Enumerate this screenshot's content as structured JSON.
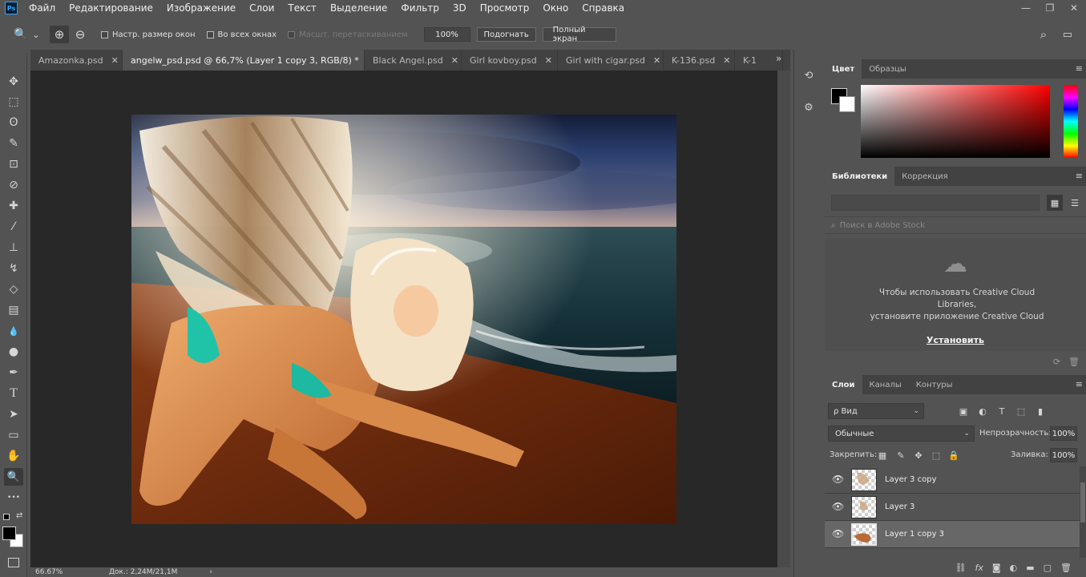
{
  "app": {
    "logo": "Ps",
    "accent": "#31a8ff"
  },
  "menu": [
    "Файл",
    "Редактирование",
    "Изображение",
    "Слои",
    "Текст",
    "Выделение",
    "Фильтр",
    "3D",
    "Просмотр",
    "Окно",
    "Справка"
  ],
  "window_controls": {
    "minimize": "—",
    "restore": "❐",
    "close": "✕"
  },
  "options": {
    "zoom_icon": "🔍",
    "chevron": "⌄",
    "zoom_in_icon": "⊕",
    "zoom_out_icon": "⊖",
    "resize_windows_label": "Настр. размер окон",
    "all_windows_label": "Во всех окнах",
    "scrubby_zoom_label": "Масшт. перетаскиванием",
    "zoom_value": "100%",
    "fit_screen_label": "Подогнать",
    "fill_screen_label": "Полный экран",
    "search_icon": "⌕",
    "workspace_icon": "▭"
  },
  "tabs": [
    {
      "title": "Amazonka.psd",
      "close": "✕",
      "active": false
    },
    {
      "title": "angelw_psd.psd @ 66,7% (Layer 1 copy 3, RGB/8) *",
      "close": "✕",
      "active": true
    },
    {
      "title": "Black Angel.psd",
      "close": "✕",
      "active": false
    },
    {
      "title": "Girl kovboy.psd",
      "close": "✕",
      "active": false
    },
    {
      "title": "Girl with cigar.psd",
      "close": "✕",
      "active": false
    },
    {
      "title": "K-136.psd",
      "close": "✕",
      "active": false
    },
    {
      "title": "K-1",
      "close": "",
      "active": false
    }
  ],
  "tab_overflow": "»",
  "tools": [
    {
      "name": "move-tool",
      "glyph": "✥"
    },
    {
      "name": "marquee-tool",
      "glyph": "⬚"
    },
    {
      "name": "lasso-tool",
      "glyph": "ʘ"
    },
    {
      "name": "quick-select-tool",
      "glyph": "✎"
    },
    {
      "name": "crop-tool",
      "glyph": "⊡"
    },
    {
      "name": "eyedropper-tool",
      "glyph": "⊘"
    },
    {
      "name": "healing-tool",
      "glyph": "✚"
    },
    {
      "name": "brush-tool",
      "glyph": "⁄"
    },
    {
      "name": "stamp-tool",
      "glyph": "⊥"
    },
    {
      "name": "history-brush-tool",
      "glyph": "↯"
    },
    {
      "name": "eraser-tool",
      "glyph": "◇"
    },
    {
      "name": "gradient-tool",
      "glyph": "▤"
    },
    {
      "name": "blur-tool",
      "glyph": "💧"
    },
    {
      "name": "dodge-tool",
      "glyph": "●"
    },
    {
      "name": "pen-tool",
      "glyph": "✒"
    },
    {
      "name": "type-tool",
      "glyph": "T"
    },
    {
      "name": "path-select-tool",
      "glyph": "➤"
    },
    {
      "name": "shape-tool",
      "glyph": "▭"
    },
    {
      "name": "hand-tool",
      "glyph": "✋"
    },
    {
      "name": "zoom-tool",
      "glyph": "🔍"
    },
    {
      "name": "more-tools",
      "glyph": "•••"
    }
  ],
  "status": {
    "zoom": "66.67%",
    "doc": "Док.: 2,24M/21,1M",
    "arrow": "›"
  },
  "strip_icons": {
    "history": "⟲",
    "properties": "⚙"
  },
  "color_panel": {
    "tabs": [
      "Цвет",
      "Образцы"
    ],
    "menu": "≡",
    "foreground": "#000000",
    "background": "#ffffff"
  },
  "libraries": {
    "tabs": [
      "Библиотеки",
      "Коррекция"
    ],
    "menu": "≡",
    "grid_icon": "▦",
    "list_icon": "☰",
    "search_placeholder": "Поиск в Adobe Stock",
    "cloud_icon": "☁",
    "msg_line1": "Чтобы использовать Creative Cloud",
    "msg_line2": "Libraries,",
    "msg_line3": "установите приложение Creative Cloud",
    "install": "Установить",
    "sync_icon": "⟳",
    "trash_icon": "🗑"
  },
  "layers": {
    "tabs": [
      "Слои",
      "Каналы",
      "Контуры"
    ],
    "menu": "≡",
    "kind_filter": "ρ Вид",
    "chevron": "⌄",
    "filter_icons": [
      "▣",
      "◐",
      "T",
      "⬚",
      "▮"
    ],
    "blend_mode": "Обычные",
    "opacity_label": "Непрозрачность:",
    "opacity_value": "100%",
    "lock_label": "Закрепить:",
    "lock_icons": [
      "▦",
      "✎",
      "✥",
      "⬚",
      "🔒"
    ],
    "fill_label": "Заливка:",
    "fill_value": "100%",
    "eye": "👁",
    "rows": [
      {
        "name": "Layer 3 copy",
        "selected": false
      },
      {
        "name": "Layer 3",
        "selected": false
      },
      {
        "name": "Layer 1 copy 3",
        "selected": true
      }
    ],
    "footer_icons": [
      "⛓",
      "fx",
      "◙",
      "◐",
      "▬",
      "▢",
      "🗑"
    ]
  }
}
